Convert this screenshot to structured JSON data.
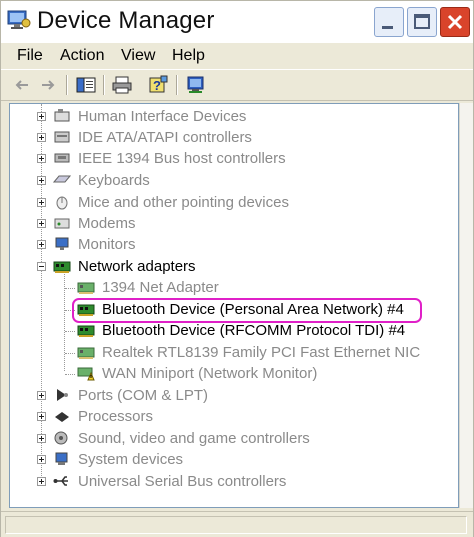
{
  "window": {
    "title": "Device Manager"
  },
  "menu": {
    "file": "File",
    "action": "Action",
    "view": "View",
    "help": "Help"
  },
  "tree": {
    "categories": [
      {
        "label": "Human Interface Devices",
        "icon": "hid-icon"
      },
      {
        "label": "IDE ATA/ATAPI controllers",
        "icon": "ide-icon"
      },
      {
        "label": "IEEE 1394 Bus host controllers",
        "icon": "ieee1394-icon"
      },
      {
        "label": "Keyboards",
        "icon": "keyboard-icon"
      },
      {
        "label": "Mice and other pointing devices",
        "icon": "mouse-icon"
      },
      {
        "label": "Modems",
        "icon": "modem-icon"
      },
      {
        "label": "Monitors",
        "icon": "monitor-icon"
      },
      {
        "label": "Network adapters",
        "icon": "network-adapter-icon",
        "expanded": true
      },
      {
        "label": "Ports (COM & LPT)",
        "icon": "port-icon"
      },
      {
        "label": "Processors",
        "icon": "processor-icon"
      },
      {
        "label": "Sound, video and game controllers",
        "icon": "sound-icon"
      },
      {
        "label": "System devices",
        "icon": "system-icon"
      },
      {
        "label": "Universal Serial Bus controllers",
        "icon": "usb-icon"
      }
    ],
    "network_children": [
      {
        "label": "1394 Net Adapter",
        "icon": "nic-icon"
      },
      {
        "label": "Bluetooth Device (Personal Area Network) #4",
        "icon": "nic-icon",
        "highlighted": true
      },
      {
        "label": "Bluetooth Device (RFCOMM Protocol TDI) #4",
        "icon": "nic-icon"
      },
      {
        "label": "Realtek RTL8139 Family PCI Fast Ethernet NIC",
        "icon": "nic-icon"
      },
      {
        "label": "WAN Miniport (Network Monitor)",
        "icon": "warning-nic-icon"
      }
    ]
  },
  "colors": {
    "highlight": "#e020c8",
    "close_button": "#d9442b",
    "nic_green": "#2e8b2e"
  }
}
